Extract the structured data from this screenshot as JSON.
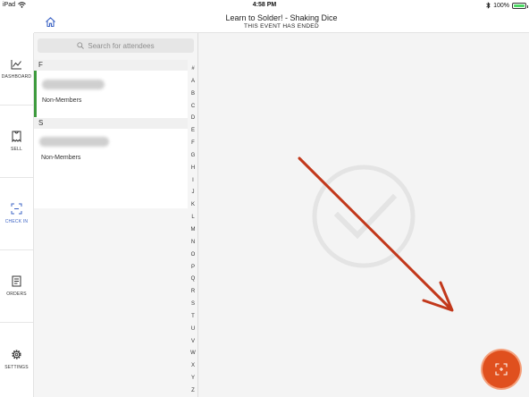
{
  "status_bar": {
    "device": "iPad",
    "time": "4:58 PM",
    "battery_text": "100%",
    "battery_level": 1.0
  },
  "header": {
    "title": "Learn to Solder! - Shaking Dice",
    "subtitle": "THIS EVENT HAS ENDED"
  },
  "nav": {
    "items": [
      {
        "label": "DASHBOARD",
        "icon": "chart-line-icon",
        "active": false
      },
      {
        "label": "SELL",
        "icon": "ticket-icon",
        "active": false
      },
      {
        "label": "CHECK IN",
        "icon": "scan-frame-icon",
        "active": true
      },
      {
        "label": "ORDERS",
        "icon": "document-icon",
        "active": false
      },
      {
        "label": "SETTINGS",
        "icon": "gear-icon",
        "active": false
      }
    ]
  },
  "search": {
    "placeholder": "Search for attendees"
  },
  "attendees": {
    "sections": [
      {
        "letter": "F",
        "rows": [
          {
            "member_type": "Non-Members",
            "selected": true
          }
        ]
      },
      {
        "letter": "S",
        "rows": [
          {
            "member_type": "Non-Members",
            "selected": false
          }
        ]
      }
    ]
  },
  "alpha_index": [
    "#",
    "A",
    "B",
    "C",
    "D",
    "E",
    "F",
    "G",
    "H",
    "I",
    "J",
    "K",
    "L",
    "M",
    "N",
    "O",
    "P",
    "Q",
    "R",
    "S",
    "T",
    "U",
    "V",
    "W",
    "X",
    "Y",
    "Z"
  ],
  "colors": {
    "accent": "#3d64c5",
    "fab": "#e0501e",
    "selected_bar": "#3e9b3e",
    "annotation_arrow": "#c2381b"
  }
}
